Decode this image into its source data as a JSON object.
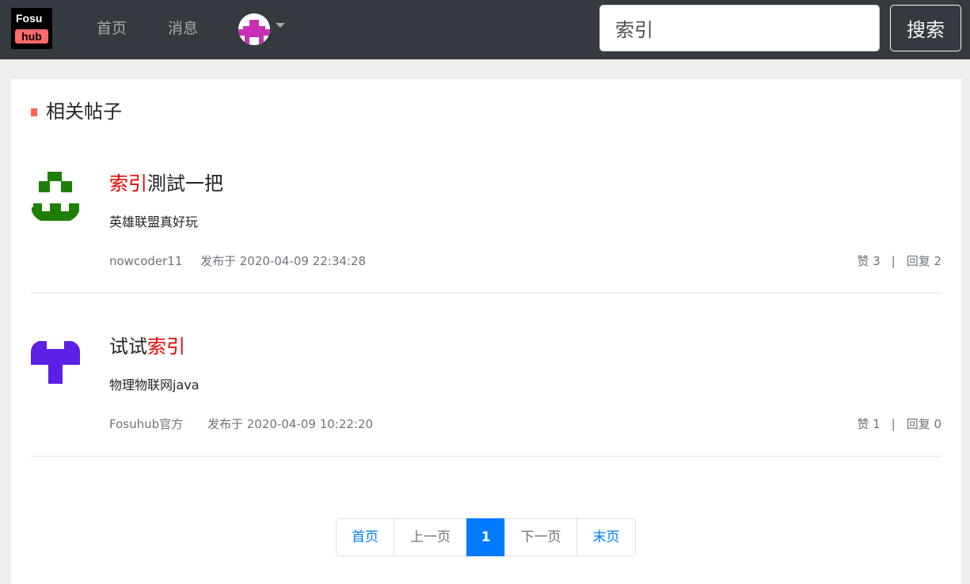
{
  "header": {
    "logo_line1": "Fosu",
    "logo_line2": "hub",
    "nav": {
      "home": "首页",
      "messages": "消息"
    },
    "search": {
      "value": "索引",
      "button": "搜索"
    }
  },
  "section": {
    "title": "相关帖子"
  },
  "posts": [
    {
      "title_highlight": "索引",
      "title_rest": "測試一把",
      "content": "英雄联盟真好玩",
      "author": "nowcoder11",
      "date": "发布于 2020-04-09 22:34:28",
      "likes": "赞 3",
      "separator": "|",
      "replies": "回复 2",
      "avatar_color": "#1e7f06"
    },
    {
      "title_prefix": "试试",
      "title_highlight": "索引",
      "content": "物理物联网java",
      "author": "Fosuhub官方",
      "date": "发布于 2020-04-09 10:22:20",
      "likes": "赞 1",
      "separator": "|",
      "replies": "回复 0",
      "avatar_color": "#5b1fe6"
    }
  ],
  "pagination": {
    "first": "首页",
    "prev": "上一页",
    "current": "1",
    "next": "下一页",
    "last": "末页"
  },
  "colors": {
    "navbar": "#343a40",
    "highlight": "#e60000",
    "accent": "#007bff",
    "marker": "#ff6347"
  }
}
